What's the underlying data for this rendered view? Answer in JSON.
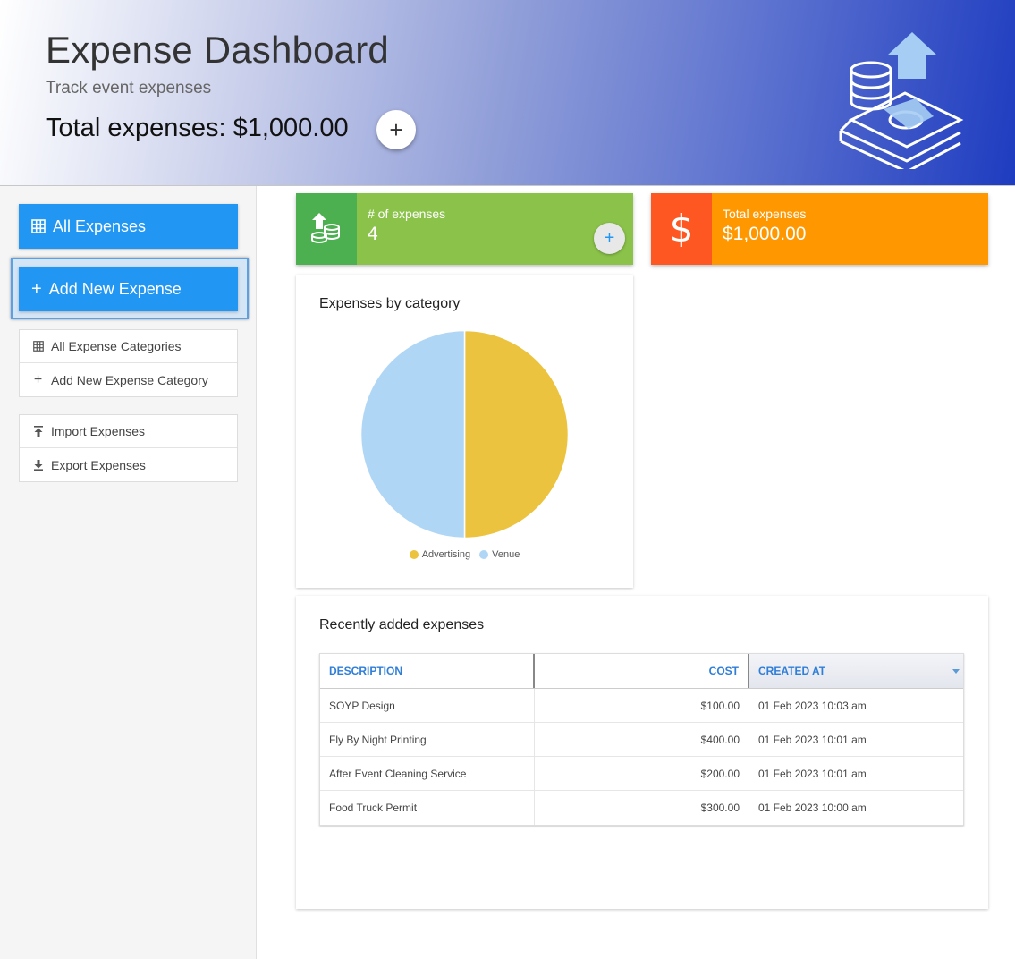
{
  "header": {
    "title": "Expense Dashboard",
    "subtitle": "Track event expenses",
    "total": "Total expenses: $1,000.00",
    "add_icon": "plus-icon"
  },
  "sidebar": {
    "all_expenses": "All Expenses",
    "add_new_expense": "Add New Expense",
    "categories": [
      {
        "label": "All Expense Categories",
        "icon": "grid-icon"
      },
      {
        "label": "Add New Expense Category",
        "icon": "plus-icon"
      }
    ],
    "io": [
      {
        "label": "Import Expenses",
        "icon": "upload-icon"
      },
      {
        "label": "Export Expenses",
        "icon": "download-icon"
      }
    ]
  },
  "cards": {
    "count": {
      "label": "# of expenses",
      "value": "4",
      "color": "#8bc34a",
      "icon_bg": "#4caf50"
    },
    "total": {
      "label": "Total expenses",
      "value": "$1,000.00",
      "color": "#ff9800",
      "icon_bg": "#ff5722"
    }
  },
  "chart_data": {
    "type": "pie",
    "title": "Expenses by category",
    "slices": [
      {
        "name": "Advertising",
        "value": 500,
        "color": "#ecc33f"
      },
      {
        "name": "Venue",
        "value": 500,
        "color": "#b0d6f6"
      }
    ],
    "legend": "bottom"
  },
  "recent": {
    "title": "Recently added expenses",
    "columns": [
      "DESCRIPTION",
      "COST",
      "CREATED AT"
    ],
    "rows": [
      [
        "SOYP Design",
        "$100.00",
        "01 Feb 2023 10:03 am"
      ],
      [
        "Fly By Night Printing",
        "$400.00",
        "01 Feb 2023 10:01 am"
      ],
      [
        "After Event Cleaning Service",
        "$200.00",
        "01 Feb 2023 10:01 am"
      ],
      [
        "Food Truck Permit",
        "$300.00",
        "01 Feb 2023 10:00 am"
      ]
    ]
  }
}
